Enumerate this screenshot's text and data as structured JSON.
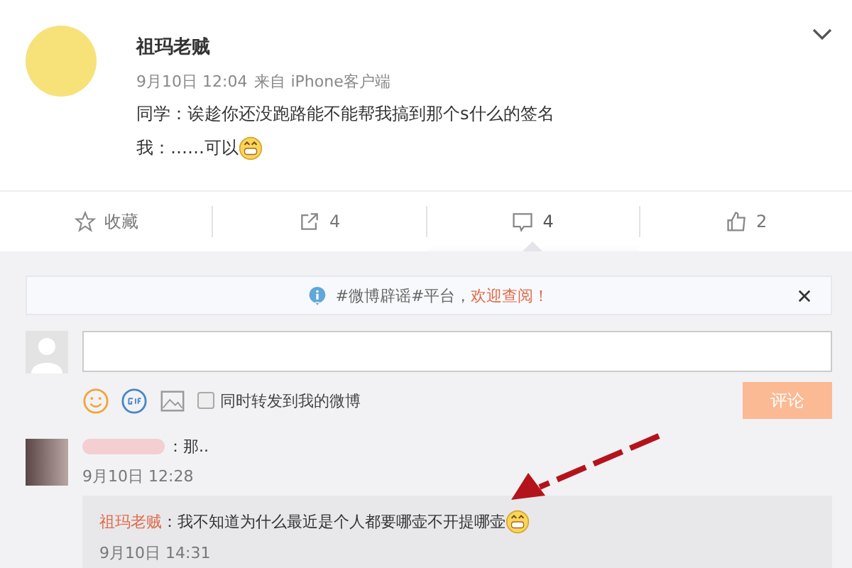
{
  "post": {
    "author": "祖玛老贼",
    "time": "9月10日 12:04",
    "source": "来自 iPhone客户端",
    "lines": [
      {
        "text": "同学：诶趁你还没跑路能不能帮我搞到那个s什么的签名",
        "emoji": false
      },
      {
        "text": "我：……可以",
        "emoji": true
      }
    ]
  },
  "actions": [
    {
      "kind": "star",
      "label": "收藏",
      "selected": false
    },
    {
      "kind": "share",
      "label": "4",
      "selected": false
    },
    {
      "kind": "comment",
      "label": "4",
      "selected": true
    },
    {
      "kind": "like",
      "label": "2",
      "selected": false
    }
  ],
  "notice": {
    "text": "#微博辟谣#平台，",
    "link": "欢迎查阅！"
  },
  "composer": {
    "checkbox_label": "同时转发到我的微博",
    "checked": false,
    "submit": "评论"
  },
  "comments": [
    {
      "text": "：那..",
      "time": "9月10日 12:28",
      "reply": {
        "author": "祖玛老贼",
        "text": "：我不知道为什么最近是个人都要哪壶不开提哪壶",
        "emoji": true,
        "time": "9月10日 14:31"
      }
    }
  ]
}
